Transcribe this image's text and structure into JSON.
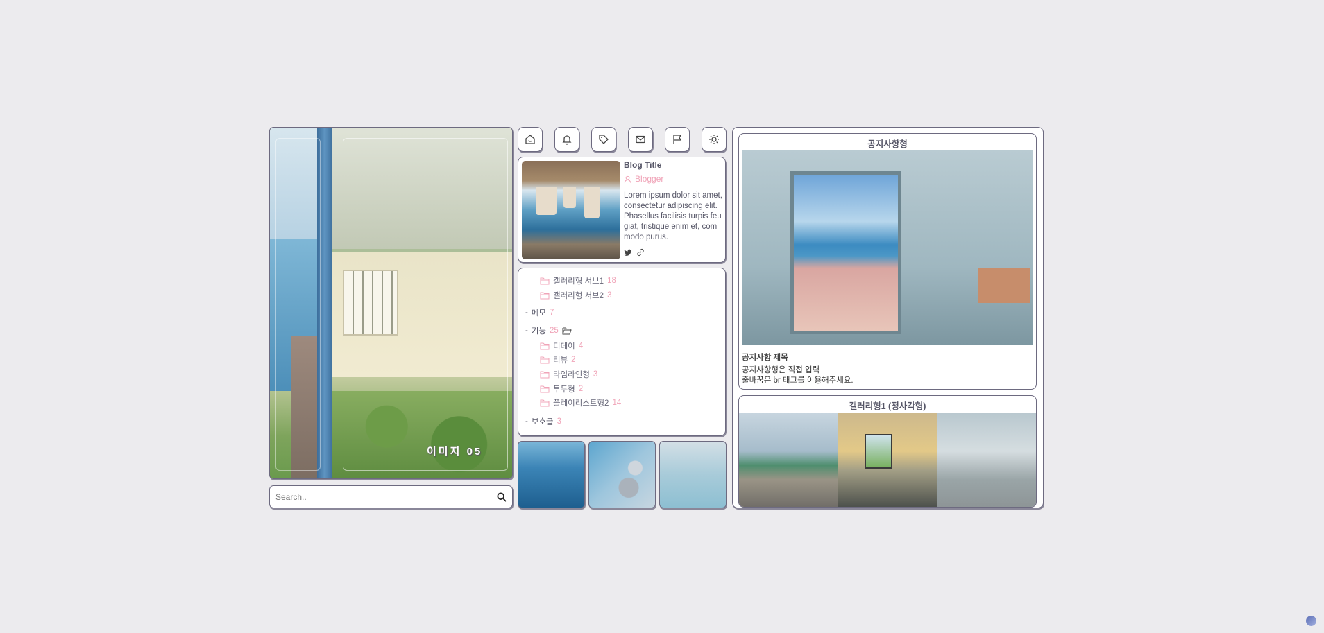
{
  "hero": {
    "caption": "이미지 05"
  },
  "search": {
    "placeholder": "Search.."
  },
  "nav_icons": [
    "home-icon",
    "bell-icon",
    "tag-icon",
    "mail-icon",
    "flag-icon",
    "sun-icon"
  ],
  "profile": {
    "title": "Blog Title",
    "author": "Blogger",
    "description": "Lorem ipsum dolor sit amet, consectetur adipiscing elit. Phasellus facilisis turpis feugiat, tristique enim et, commodo purus."
  },
  "categories": {
    "sub1": {
      "label": "갤러리형 서브1",
      "count": "18"
    },
    "sub2": {
      "label": "갤러리형 서브2",
      "count": "3"
    },
    "memo": {
      "label": "메모",
      "count": "7"
    },
    "feature": {
      "label": "기능",
      "count": "25"
    },
    "feature_items": [
      {
        "label": "디데이",
        "count": "4"
      },
      {
        "label": "리뷰",
        "count": "2"
      },
      {
        "label": "타임라인형",
        "count": "3"
      },
      {
        "label": "투두형",
        "count": "2"
      },
      {
        "label": "플레이리스트형2",
        "count": "14"
      }
    ],
    "protected": {
      "label": "보호글",
      "count": "3"
    }
  },
  "notice": {
    "header": "공지사항형",
    "title": "공지사항 제목",
    "body_line1": "공지사항형은 직접 입력",
    "body_line2": "줄바꿈은 br 태그를 이용해주세요."
  },
  "gallery": {
    "header": "갤러리형1 (정사각형)"
  },
  "colors": {
    "accent_pink": "#f0a4b8",
    "border": "#6d6a80",
    "background": "#ecebee"
  }
}
